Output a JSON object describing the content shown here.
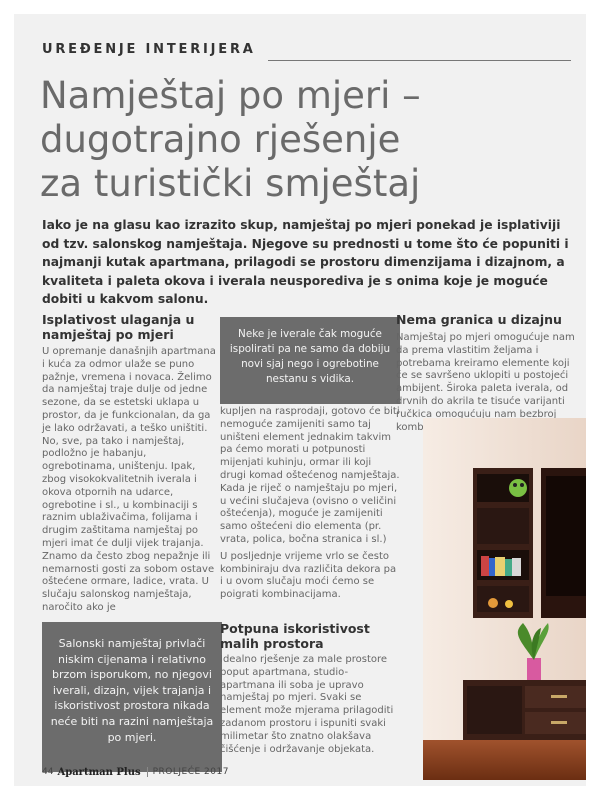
{
  "section_label": "UREĐENJE INTERIJERA",
  "headline": [
    "Namještaj po mjeri –",
    "dugotrajno rješenje",
    "za turistički smještaj"
  ],
  "lead": "Iako je na glasu kao izrazito skup, namještaj po mjeri ponekad je isplativiji od tzv. salonskog namještaja. Njegove su prednosti u tome što će popuniti i najmanji kutak apartmana, prilagodi se prostoru dimenzijama i dizajnom, a kvaliteta i paleta okova i iverala neusporediva je s onima koje je moguće dobiti u kakvom salonu.",
  "col1": {
    "heading": "Isplativost ulaganja u namještaj po mjeri",
    "paragraphs": [
      "U opremanje današnjih apartmana i kuća za odmor ulaže se puno pažnje, vremena i novaca. Želimo da namještaj traje dulje od jedne sezone, da se estetski uklapa u prostor, da je funkcionalan, da ga je lako održavati, a teško uništiti. No, sve, pa tako i namještaj, podložno je habanju, ogrebotinama, uništenju. Ipak, zbog visokokvalitetnih iverala i okova otpornih na udarce, ogrebotine i sl., u kombinaciji s raznim ublaživačima, folijama i drugim zaštitama namještaj po mjeri imat će dulji vijek trajanja.",
      "Znamo da često zbog nepažnje ili nemarnosti gosti za sobom ostave oštećene ormare, ladice, vrata. U slučaju salonskog namještaja, naročito ako je"
    ]
  },
  "quote1": "Neke je iverale čak moguće ispolirati pa ne samo da dobiju novi sjaj nego i ogrebotine nestanu s vidika.",
  "quote2": "Salonski namještaj privlači niskim cijenama i relativno brzom isporukom, no njegovi iverali, dizajn, vijek trajanja i iskoristivost prostora nikada neće biti na razini namještaja po mjeri.",
  "col2": {
    "paragraphs": [
      "kupljen na rasprodaji, gotovo će biti nemoguće zamijeniti samo taj uništeni element jednakim takvim pa ćemo morati u potpunosti mijenjati kuhinju, ormar ili koji drugi komad oštećenog namještaja.",
      "Kada je riječ o namještaju po mjeri, u većini slučajeva (ovisno o veličini oštećenja), moguće je zamijeniti samo oštećeni dio elementa (pr. vrata, polica, bočna stranica i sl.)",
      "U posljednje vrijeme vrlo se često kombiniraju dva različita dekora pa i u ovom slučaju moći ćemo se poigrati kombinacijama."
    ],
    "heading2": "Potpuna iskoristivost malih prostora",
    "paragraphs2": [
      "Idealno rješenje za male prostore poput apartmana, studio-apartmana ili soba je upravo namještaj po mjeri. Svaki se element može mjerama prilagoditi zadanom prostoru i ispuniti svaki milimetar što znatno olakšava čišćenje i održavanje objekata."
    ]
  },
  "col3": {
    "heading": "Nema granica u dizajnu",
    "text": "Namještaj po mjeri omogućuje nam da prema vlastitim željama i potrebama kreiramo elemente koji će se savršeno uklopiti u postojeći ambijent. Široka paleta iverala, od drvnih do akrila te tisuće varijanti ručkica omogućuju nam bezbroj kombinacija. Sve što fizički"
  },
  "footer": {
    "page_number": "44",
    "brand": "Apartman Plus",
    "issue": "PROLJEĆE 2017"
  },
  "colors": {
    "page_bg": "#f1f1f1",
    "quote_bg": "#6c6c6c",
    "furniture_dark": "#3a1f17",
    "wall": "#f2e4da"
  }
}
